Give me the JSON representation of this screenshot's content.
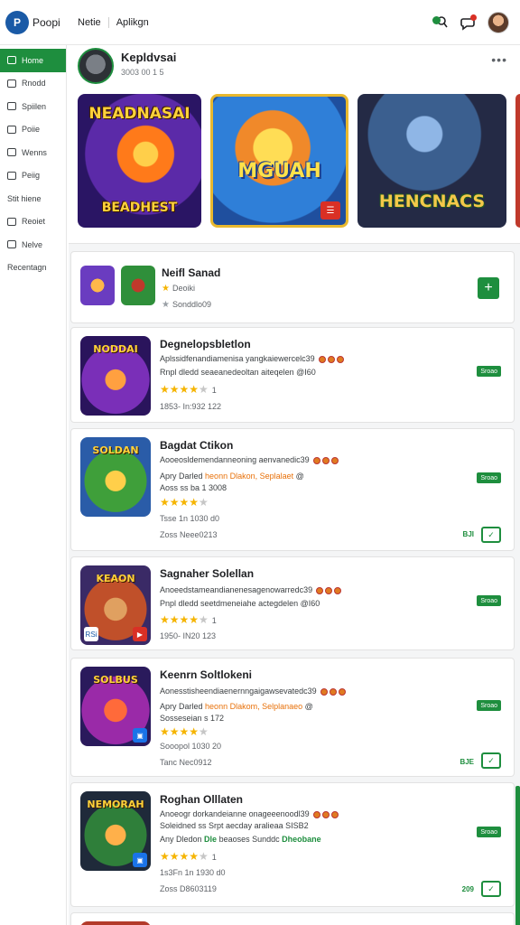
{
  "app": {
    "logo_mark": "P",
    "logo_text": "Poopi"
  },
  "topnav": [
    "Netie",
    "Aplikgn"
  ],
  "icons": {
    "notif": "people-icon",
    "search": "search-icon",
    "msg": "chat-icon"
  },
  "sidebar": {
    "items": [
      {
        "label": "Home",
        "active": true,
        "icon": true
      },
      {
        "label": "Rnodd",
        "icon": true
      },
      {
        "label": "Spiilen",
        "icon": true
      },
      {
        "label": "Poiie",
        "icon": true
      },
      {
        "label": "Wenns",
        "icon": true
      },
      {
        "label": "Peiig",
        "icon": true
      },
      {
        "label": "Stit hiene",
        "icon": false
      },
      {
        "label": "Reoiet",
        "icon": true
      },
      {
        "label": "Nelve",
        "icon": true
      },
      {
        "label": "Recentagn",
        "icon": false
      }
    ]
  },
  "hero": {
    "name": "Kepldvsai",
    "subtitle": "3003 00 1 5",
    "more": "•••",
    "banners": [
      {
        "title": "NEADNASAI",
        "subtitle": "BEADHEST"
      },
      {
        "title": "MGUAH",
        "badge": "☰"
      },
      {
        "title": "HENCNACS"
      }
    ]
  },
  "featured": {
    "title": "Neifl Sanad",
    "line1": "Deoiki",
    "line2": "Sonddlo09"
  },
  "cards": [
    {
      "title": "Degnelopsbletlon",
      "desc": "Aplssidfenandiamenisa yangkaiewercelc39",
      "line2": "Rnpl dledd  seaeanedeoltan aiteqelen  @I60",
      "rating_count": "1",
      "meta": "1853- In:932 122",
      "pill": "Sroao"
    },
    {
      "title": "Bagdat Ctikon",
      "desc": "Aooeosldemendanneoning aenvanedic39",
      "line2a": "Apry Darled",
      "line2b": "heonn Dlakon, Seplalaet",
      "line2c": "@",
      "line3": "Aoss ss ba 1 3008",
      "meta1": "Tsse 1n 1030 d0",
      "meta2": "Zoss Neee0213",
      "pill": "Sroao",
      "side": "BJI"
    },
    {
      "title": "Sagnaher Solellan",
      "desc": "Anoeedstameandianenesagenowarredc39",
      "line2": "Pnpl dledd  seetdmeneiahe actegdelen  @I60",
      "rating_count": "1",
      "meta": "1950- IN20 123",
      "pill": "Sroao",
      "thumb_label": "RSi"
    },
    {
      "title": "Keenrn Soltlokeni",
      "desc": "Aonesstisheendiaenernngaigawsevatedc39",
      "line2a": "Apry Darled",
      "line2b": "heonn Dlakom, Selplanaeo",
      "line2c": "@",
      "line3": "Sosseseian s 172",
      "meta1": "Sooopol 1030 20",
      "meta2": "Tanc Nec0912",
      "pill": "Sroao",
      "side": "BJE"
    },
    {
      "title": "Roghan Olllaten",
      "desc": "Anoeogr dorkandeianne onageeenoodl39",
      "line2": "Soleidned ss Srpt aecday aralieaa   SISB2",
      "line3a": "Any  Dledon",
      "line3b": "Dle",
      "line3c": "beaoses  Sunddc",
      "line3d": "Dheobane",
      "rating_count": "1",
      "meta1": "1s3Fn 1n 1930 d0",
      "meta2": "Zoss D8603119",
      "pill": "Sroao",
      "side": "209"
    }
  ]
}
